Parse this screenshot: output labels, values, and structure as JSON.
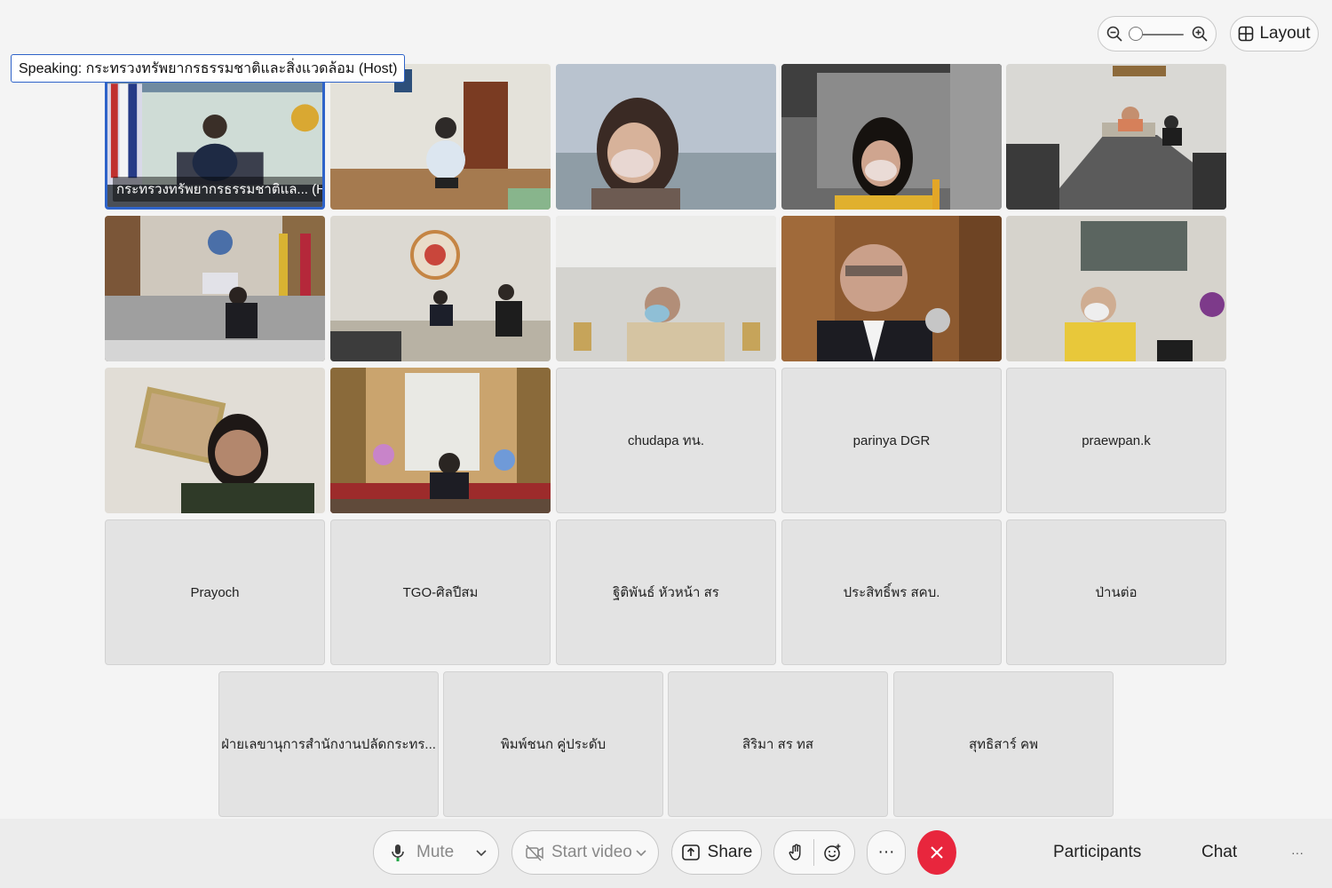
{
  "top_controls": {
    "zoom": {
      "out_icon": "zoom-out-icon",
      "in_icon": "zoom-in-icon",
      "level": 0
    },
    "layout_label": "Layout"
  },
  "speaking_banner": "Speaking: กระทรวงทรัพยากรธรรมชาติและสิ่งแวดล้อม (Host)",
  "video_tiles": {
    "host_label": "กระทรวงทรัพยากรธรรมชาติแล... (Host)"
  },
  "name_tiles": [
    "chudapa ทน.",
    "parinya DGR",
    "praewpan.k",
    "Prayoch",
    "TGO-ศิลปีสม",
    "ฐิติพันธ์ หัวหน้า สร",
    "ประสิทธิ์พร สคบ.",
    "ป่านต่อ",
    "ฝ่ายเลขานุการสำนักงานปลัดกระทร...",
    "พิมพ์ชนก คู่ประดับ",
    "สิริมา สร ทส",
    "สุทธิสาร์ คพ"
  ],
  "toolbar": {
    "mute": "Mute",
    "start_video": "Start video",
    "share": "Share",
    "more": "···",
    "participants": "Participants",
    "chat": "Chat",
    "overflow": "···"
  },
  "colors": {
    "accent": "#2e63c9",
    "end_call": "#e8263d"
  }
}
